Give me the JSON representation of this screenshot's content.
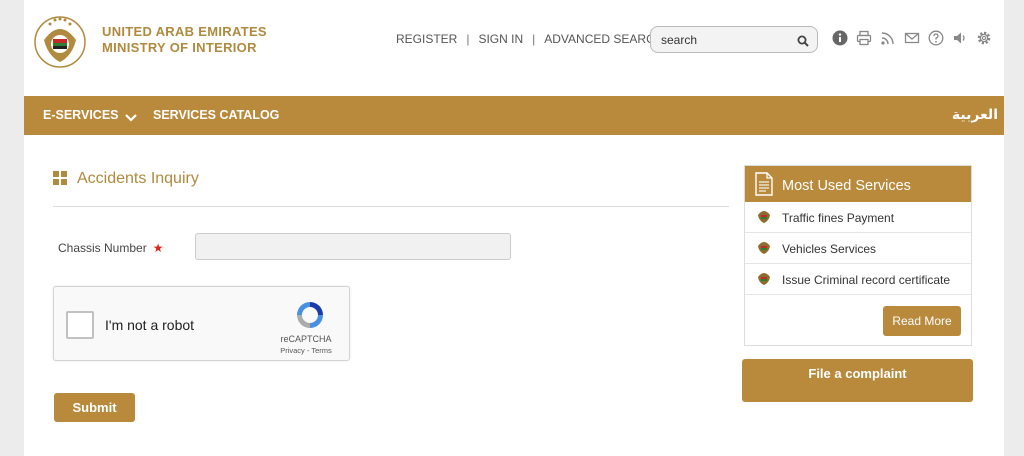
{
  "header": {
    "brand_line1": "UNITED ARAB EMIRATES",
    "brand_line2": "MINISTRY OF INTERIOR",
    "links": [
      "REGISTER",
      "SIGN IN",
      "ADVANCED SEARCH"
    ],
    "link_separator": "|",
    "search": {
      "placeholder": "search",
      "value": ""
    },
    "tool_icons": [
      "info-icon",
      "print-icon",
      "rss-icon",
      "mail-icon",
      "help-icon",
      "volume-icon",
      "gear-icon"
    ]
  },
  "nav": {
    "eservices": "E-SERVICES",
    "catalog": "SERVICES CATALOG",
    "language": "العربية"
  },
  "main": {
    "title": "Accidents Inquiry",
    "chassis_label": "Chassis Number",
    "required_mark": "★",
    "recaptcha": {
      "label": "I'm not a robot",
      "brand": "reCAPTCHA",
      "terms": "Privacy - Terms"
    },
    "submit": "Submit"
  },
  "sidebar": {
    "title": "Most Used Services",
    "items": [
      {
        "label": "Traffic fines Payment"
      },
      {
        "label": "Vehicles Services"
      },
      {
        "label": "Issue Criminal record certificate"
      }
    ],
    "read_more": "Read More",
    "complaint": "File a complaint"
  },
  "colors": {
    "accent": "#b9893c",
    "brand_text": "#b08a3e",
    "required": "#d9261c"
  }
}
